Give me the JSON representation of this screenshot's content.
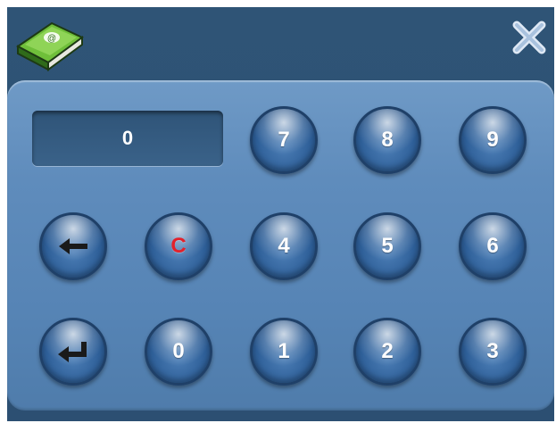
{
  "display": {
    "value": "0"
  },
  "icons": {
    "app_logo": "book-icon",
    "close": "close-icon",
    "backspace": "arrow-left-icon",
    "enter": "enter-return-icon"
  },
  "keys": {
    "k7": "7",
    "k8": "8",
    "k9": "9",
    "k4": "4",
    "k5": "5",
    "k6": "6",
    "k1": "1",
    "k2": "2",
    "k3": "3",
    "k0": "0",
    "clear": "C"
  },
  "colors": {
    "window_bg": "#2f5476",
    "panel_bg": "#5f8cbc",
    "key_bg": "#2e5f98",
    "clear_text": "#e3212b"
  }
}
